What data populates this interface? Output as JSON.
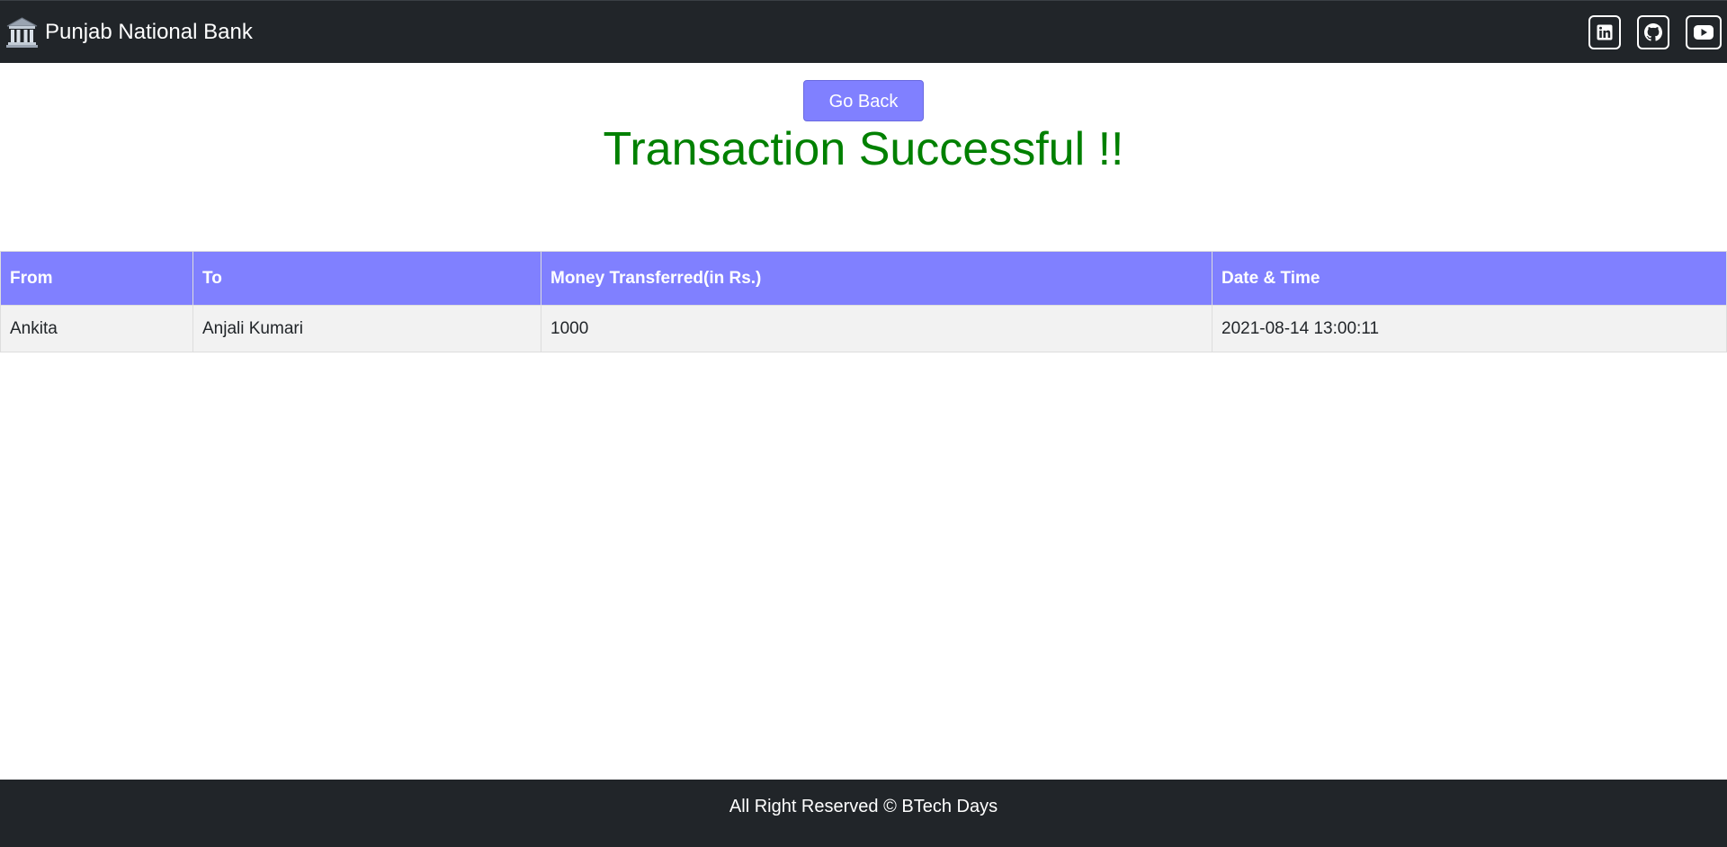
{
  "navbar": {
    "brand": "Punjab National Bank",
    "bank_icon": "bank-icon",
    "social_icons": [
      "linkedin-icon",
      "github-icon",
      "youtube-icon"
    ]
  },
  "actions": {
    "go_back_label": "Go Back"
  },
  "status": {
    "message": "Transaction Successful !!",
    "color": "#008000"
  },
  "table": {
    "headers": [
      "From",
      "To",
      "Money Transferred(in Rs.)",
      "Date & Time"
    ],
    "rows": [
      [
        "Ankita",
        "Anjali Kumari",
        "1000",
        "2021-08-14 13:00:11"
      ]
    ],
    "header_color": "#8080ff"
  },
  "footer": {
    "text": "All Right Reserved © BTech Days"
  },
  "colors": {
    "navbar_bg": "#212529",
    "button_bg": "#8080ff"
  }
}
